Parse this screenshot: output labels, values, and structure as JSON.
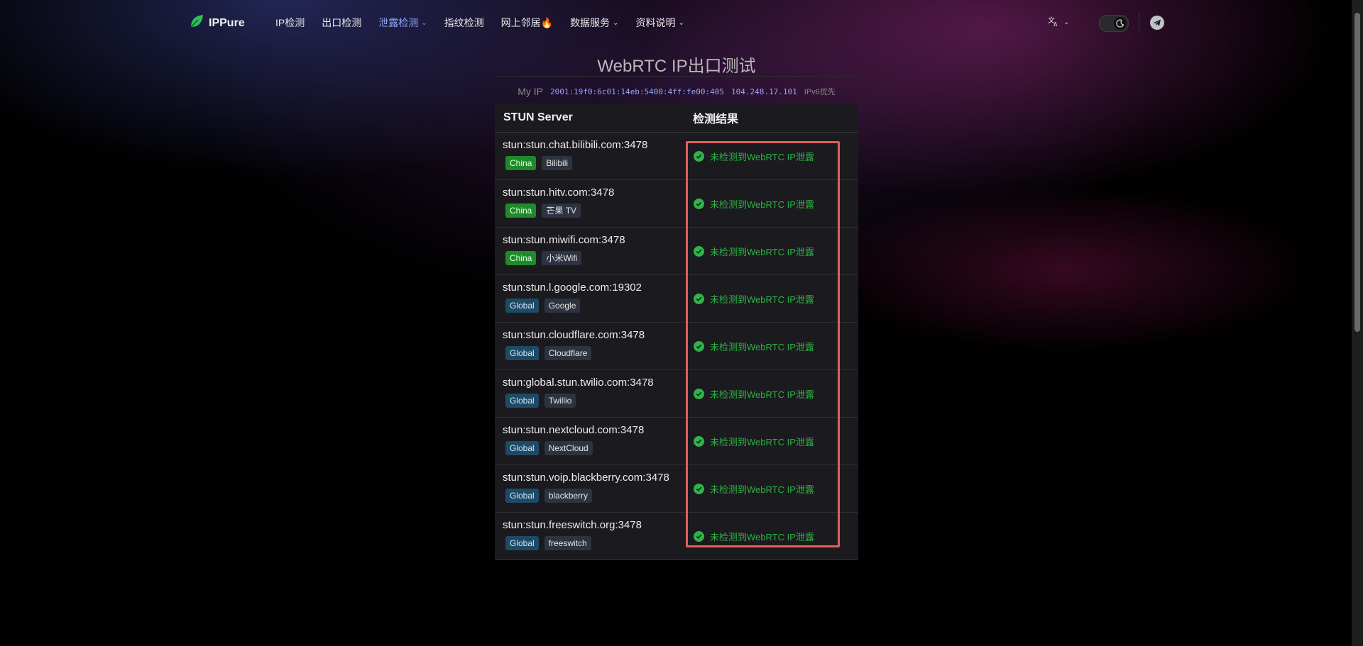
{
  "colors": {
    "accent": "#8ea4f5",
    "ok": "#2cb343",
    "china_tag": "#1f8a2a",
    "global_tag": "#1f4a66",
    "highlight": "#e35d5d"
  },
  "nav": {
    "brand": "IPPure",
    "items": [
      {
        "label": "IP检测",
        "dropdown": false
      },
      {
        "label": "出口检测",
        "dropdown": false
      },
      {
        "label": "泄露检测",
        "dropdown": true,
        "active": true
      },
      {
        "label": "指纹检测",
        "dropdown": false
      },
      {
        "label": "网上邻居🔥",
        "dropdown": false
      },
      {
        "label": "数据服务",
        "dropdown": true
      },
      {
        "label": "资料说明",
        "dropdown": true
      }
    ],
    "language_icon": "translate-icon",
    "theme_icon": "moon-icon",
    "social_icon": "telegram-icon"
  },
  "page": {
    "title": "WebRTC IP出口测试",
    "my_ip_label": "My IP",
    "ipv6": "2001:19f0:6c01:14eb:5400:4ff:fe00:405",
    "ipv4": "104.248.17.101",
    "preference": "IPv6优先"
  },
  "table": {
    "headers": [
      "STUN Server",
      "检测结果"
    ],
    "rows": [
      {
        "server": "stun:stun.chat.bilibili.com:3478",
        "region": "China",
        "provider": "Bilibili",
        "result": "未检测到WebRTC IP泄露"
      },
      {
        "server": "stun:stun.hitv.com:3478",
        "region": "China",
        "provider": "芒果 TV",
        "result": "未检测到WebRTC IP泄露"
      },
      {
        "server": "stun:stun.miwifi.com:3478",
        "region": "China",
        "provider": "小米Wifi",
        "result": "未检测到WebRTC IP泄露"
      },
      {
        "server": "stun:stun.l.google.com:19302",
        "region": "Global",
        "provider": "Google",
        "result": "未检测到WebRTC IP泄露"
      },
      {
        "server": "stun:stun.cloudflare.com:3478",
        "region": "Global",
        "provider": "Cloudflare",
        "result": "未检测到WebRTC IP泄露"
      },
      {
        "server": "stun:global.stun.twilio.com:3478",
        "region": "Global",
        "provider": "Twillio",
        "result": "未检测到WebRTC IP泄露"
      },
      {
        "server": "stun:stun.nextcloud.com:3478",
        "region": "Global",
        "provider": "NextCloud",
        "result": "未检测到WebRTC IP泄露"
      },
      {
        "server": "stun:stun.voip.blackberry.com:3478",
        "region": "Global",
        "provider": "blackberry",
        "result": "未检测到WebRTC IP泄露"
      },
      {
        "server": "stun:stun.freeswitch.org:3478",
        "region": "Global",
        "provider": "freeswitch",
        "result": "未检测到WebRTC IP泄露"
      }
    ]
  }
}
